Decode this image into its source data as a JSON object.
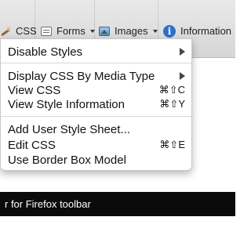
{
  "toolbar": {
    "items": [
      {
        "icon": "pencil-icon",
        "label": "CSS",
        "has_dropdown": true
      },
      {
        "icon": "forms-icon",
        "label": "Forms",
        "has_dropdown": true
      },
      {
        "icon": "images-icon",
        "label": "Images",
        "has_dropdown": true
      },
      {
        "icon": "info-icon",
        "label": "Information",
        "has_dropdown": false
      }
    ]
  },
  "menu": {
    "items": [
      {
        "label": "Disable Styles",
        "submenu": true,
        "shortcut": ""
      },
      {
        "label": "Display CSS By Media Type",
        "submenu": true,
        "shortcut": ""
      },
      {
        "label": "View CSS",
        "submenu": false,
        "shortcut": "⌘⇧C"
      },
      {
        "label": "View Style Information",
        "submenu": false,
        "shortcut": "⌘⇧Y"
      },
      {
        "label": "Add User Style Sheet...",
        "submenu": false,
        "shortcut": ""
      },
      {
        "label": "Edit CSS",
        "submenu": false,
        "shortcut": "⌘⇧E"
      },
      {
        "label": "Use Border Box Model",
        "submenu": false,
        "shortcut": ""
      }
    ]
  },
  "caption": {
    "text": "r for Firefox toolbar"
  }
}
